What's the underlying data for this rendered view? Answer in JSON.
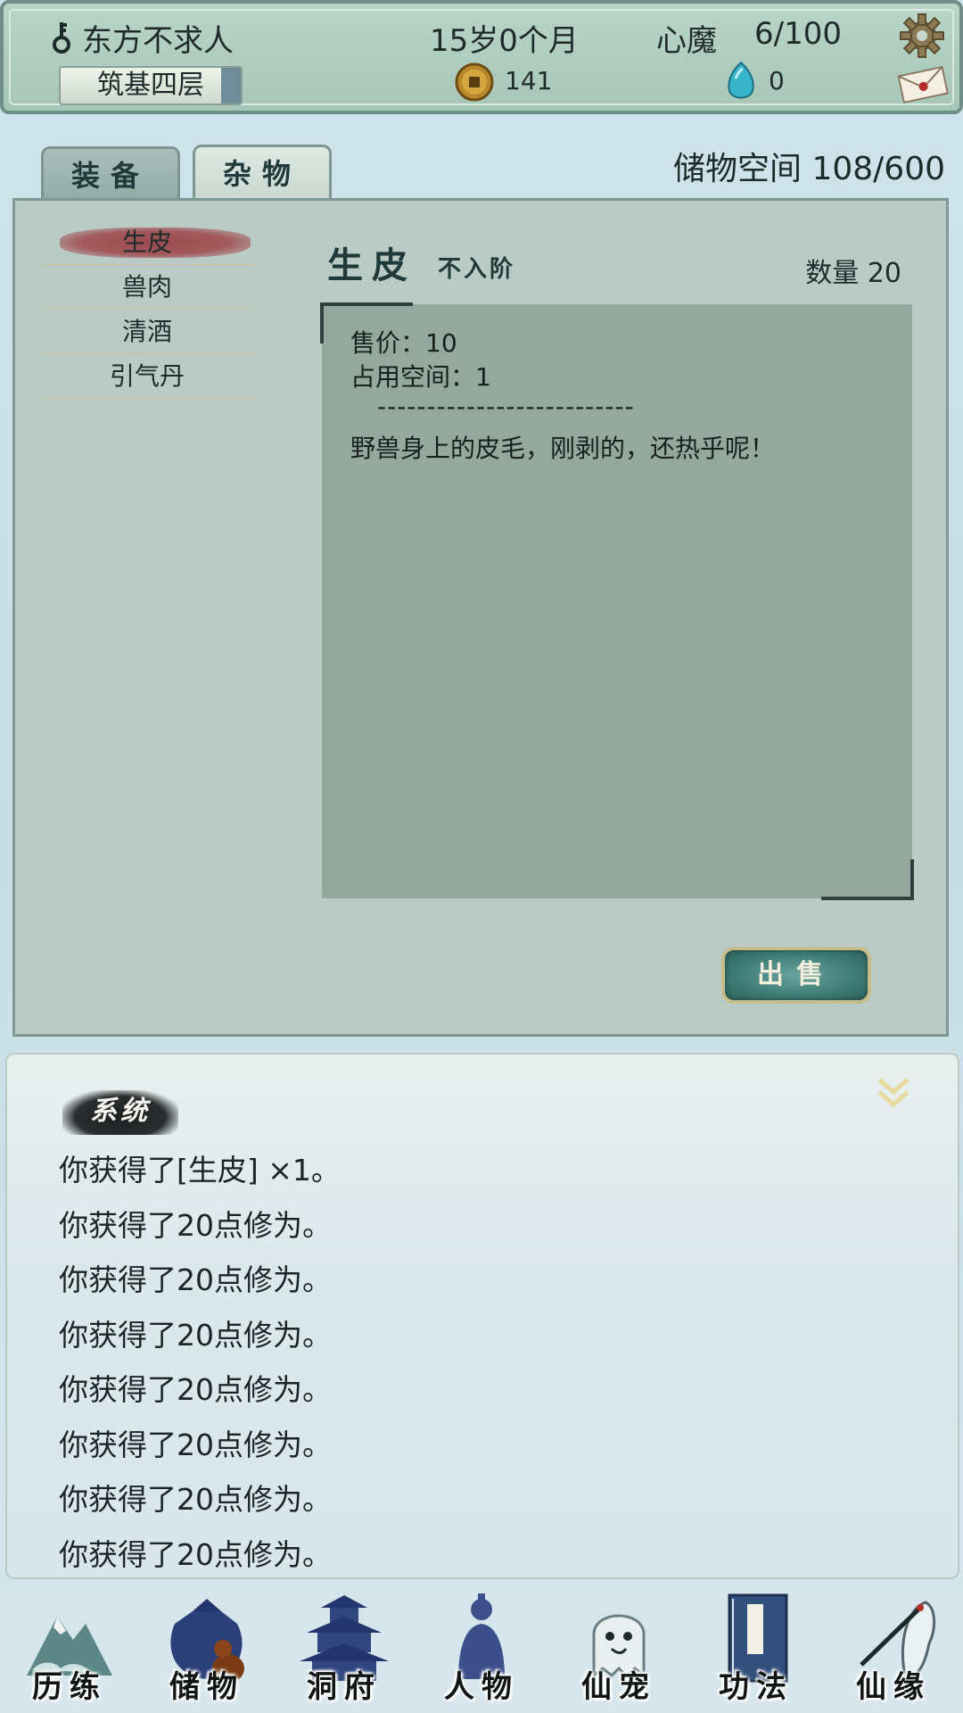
{
  "header": {
    "player_name": "东方不求人",
    "realm": "筑基四层",
    "age": "15岁0个月",
    "demon_label": "心魔",
    "demon_value": "6/100",
    "coins": "141",
    "spirit_stones": "0",
    "icons": [
      "key-icon",
      "coin-icon",
      "spirit-stone-icon",
      "gear-icon",
      "mail-icon"
    ]
  },
  "tabs": [
    {
      "label": "装备",
      "active": false
    },
    {
      "label": "杂物",
      "active": true
    }
  ],
  "storage": "储物空间  108/600",
  "items": [
    {
      "label": "生皮",
      "selected": true
    },
    {
      "label": "兽肉",
      "selected": false
    },
    {
      "label": "清酒",
      "selected": false
    },
    {
      "label": "引气丹",
      "selected": false
    }
  ],
  "detail": {
    "name": "生皮",
    "grade": "不入阶",
    "quantity": "数量 20",
    "price": "售价：10",
    "space": "占用空间：1",
    "separator": "--------------------------",
    "description": "野兽身上的皮毛，刚剥的，还热乎呢！",
    "sell_label": "出售"
  },
  "log": {
    "title": "系统",
    "lines": [
      "你获得了[生皮] ×1。",
      "你获得了20点修为。",
      "你获得了20点修为。",
      "你获得了20点修为。",
      "你获得了20点修为。",
      "你获得了20点修为。",
      "你获得了20点修为。",
      "你获得了20点修为。"
    ]
  },
  "nav": [
    {
      "label": "历练",
      "icon": "mountain-cloud-icon"
    },
    {
      "label": "储物",
      "icon": "bag-gourd-icon"
    },
    {
      "label": "洞府",
      "icon": "pavilion-icon"
    },
    {
      "label": "人物",
      "icon": "person-icon"
    },
    {
      "label": "仙宠",
      "icon": "ghost-pet-icon"
    },
    {
      "label": "功法",
      "icon": "book-icon"
    },
    {
      "label": "仙缘",
      "icon": "crane-icon"
    }
  ],
  "colors": {
    "header_bg": "#a6c6b8",
    "panel_bg": "#b9cbc4",
    "desc_bg": "#94a89d",
    "selected_item": "#9b4a4e",
    "sell_button": "#3d7c75"
  }
}
